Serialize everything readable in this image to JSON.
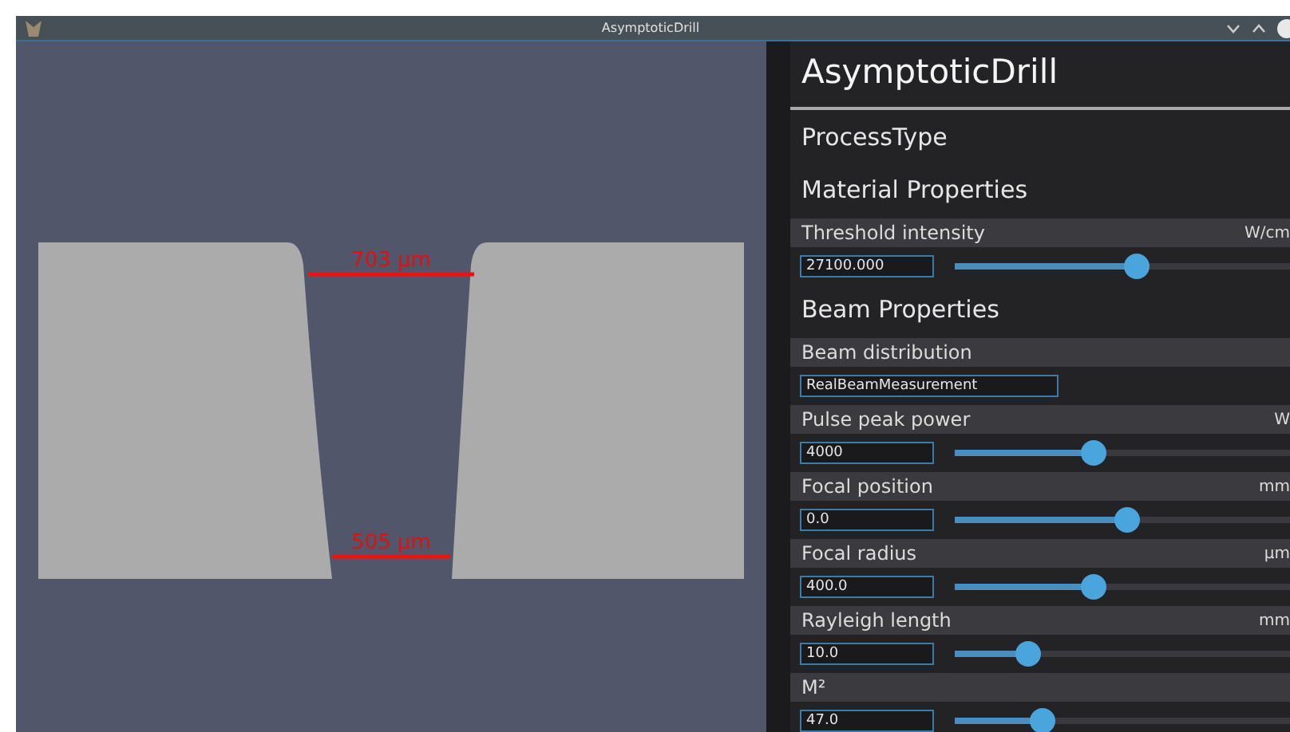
{
  "window": {
    "title": "AsymptoticDrill"
  },
  "viewport": {
    "measurements": [
      {
        "kind": "top",
        "label": "703 µm"
      },
      {
        "kind": "bottom",
        "label": "505 µm"
      }
    ]
  },
  "panel": {
    "title": "AsymptoticDrill",
    "sections": [
      {
        "kind": "heading",
        "title": "ProcessType"
      },
      {
        "kind": "heading",
        "title": "Material Properties"
      },
      {
        "kind": "slider",
        "label": "Threshold intensity",
        "unit": "W/cm",
        "value": "27100.000",
        "level": 0.54
      },
      {
        "kind": "heading",
        "title": "Beam Properties"
      },
      {
        "kind": "select",
        "label": "Beam distribution",
        "value": "RealBeamMeasurement"
      },
      {
        "kind": "slider",
        "label": "Pulse peak power",
        "unit": "W",
        "value": "4000",
        "level": 0.41
      },
      {
        "kind": "slider",
        "label": "Focal position",
        "unit": "mm",
        "value": "0.0",
        "level": 0.51
      },
      {
        "kind": "slider",
        "label": "Focal radius",
        "unit": "µm",
        "value": "400.0",
        "level": 0.41
      },
      {
        "kind": "slider",
        "label": "Rayleigh length",
        "unit": "mm",
        "value": "10.0",
        "level": 0.22
      },
      {
        "kind": "slider",
        "label": "M²",
        "value": "47.0",
        "level": 0.26
      }
    ]
  }
}
